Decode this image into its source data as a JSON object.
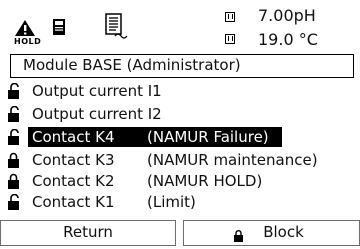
{
  "status": {
    "hold_label": "HOLD",
    "measurement_1": "7.00pH",
    "measurement_2": "19.0 °C",
    "icons": [
      "hold-warning-icon",
      "memory-card-icon",
      "document-icon",
      "sensor-icon"
    ]
  },
  "module_title": "Module BASE (Administrator)",
  "menu": {
    "items": [
      {
        "label": "Output current I1",
        "function": "",
        "selected": false
      },
      {
        "label": "Output current I2",
        "function": "",
        "selected": false
      },
      {
        "label": "Contact K4",
        "function": "(NAMUR Failure)",
        "selected": true
      },
      {
        "label": "Contact K3",
        "function": "(NAMUR maintenance)",
        "selected": false
      },
      {
        "label": "Contact K2",
        "function": "(NAMUR HOLD)",
        "selected": false
      },
      {
        "label": "Contact K1",
        "function": "(Limit)",
        "selected": false
      }
    ]
  },
  "softkeys": {
    "left_label": "Return",
    "right_label": "Block"
  },
  "colors": {
    "background": "#ffffff",
    "foreground": "#111111",
    "selection": "#000000",
    "softkey_border": "#6e6e6e"
  }
}
